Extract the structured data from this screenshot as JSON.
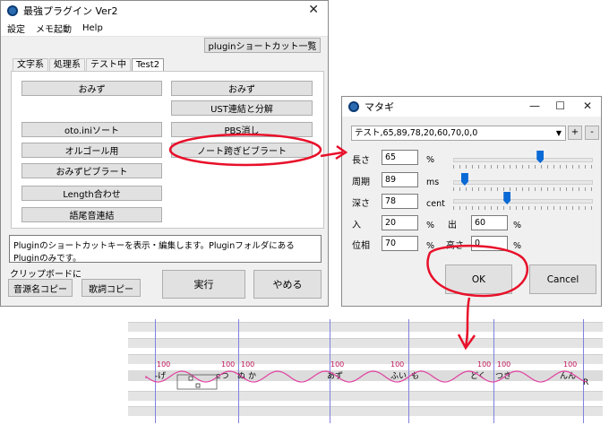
{
  "main_window": {
    "title": "最強プラグイン Ver2",
    "menu": [
      "設定",
      "メモ起動",
      "Help"
    ],
    "shortcut_list_button": "pluginショートカット一覧",
    "tabs": [
      "文字系",
      "処理系",
      "テスト中",
      "Test2"
    ],
    "active_tab": "Test2",
    "buttons_left": [
      "おみず",
      "oto.iniソート",
      "オルゴール用",
      "おみずピブラート",
      "Length合わせ",
      "語尾音連結"
    ],
    "buttons_right": [
      "おみず",
      "UST連結と分解",
      "PBS消し",
      "ノート跨ぎビブラート"
    ],
    "description": "Pluginのショートカットキーを表示・編集します。Pluginフォルダにある Pluginのみです。",
    "clipboard_label": "クリップボードに",
    "copy_source_button": "音源名コピー",
    "copy_lyrics_button": "歌詞コピー",
    "run_button": "実行",
    "quit_button": "やめる"
  },
  "dialog": {
    "title": "マタギ",
    "preset": "テスト,65,89,78,20,60,70,0,0",
    "plus": "+",
    "minus": "-",
    "length": {
      "label": "長さ",
      "value": "65",
      "unit": "%",
      "slider_fraction": 0.63
    },
    "period": {
      "label": "周期",
      "value": "89",
      "unit": "ms",
      "slider_fraction": 0.06
    },
    "depth": {
      "label": "深さ",
      "value": "78",
      "unit": "cent",
      "slider_fraction": 0.38
    },
    "fade_in": {
      "label": "入",
      "value": "20",
      "unit": "%"
    },
    "fade_out": {
      "label": "出",
      "value": "60",
      "unit": "%"
    },
    "phase": {
      "label": "位相",
      "value": "70",
      "unit": "%"
    },
    "height": {
      "label": "高さ",
      "value": "0",
      "unit": "%"
    },
    "ok": "OK",
    "cancel": "Cancel"
  },
  "editor": {
    "velocities": [
      "100",
      "100",
      "100",
      "100",
      "100",
      "100",
      "100",
      "100"
    ],
    "lyrics": [
      "-げ",
      "eつ",
      "ぬ",
      "か",
      "あず",
      "ふい",
      "も",
      "どく",
      "つき",
      "んん"
    ],
    "rest": "R"
  },
  "colors": {
    "annotation": "#e8102a",
    "vibrato": "#e040a0",
    "bar_line": "#8080e0",
    "slider_thumb": "#0a6ad6"
  }
}
